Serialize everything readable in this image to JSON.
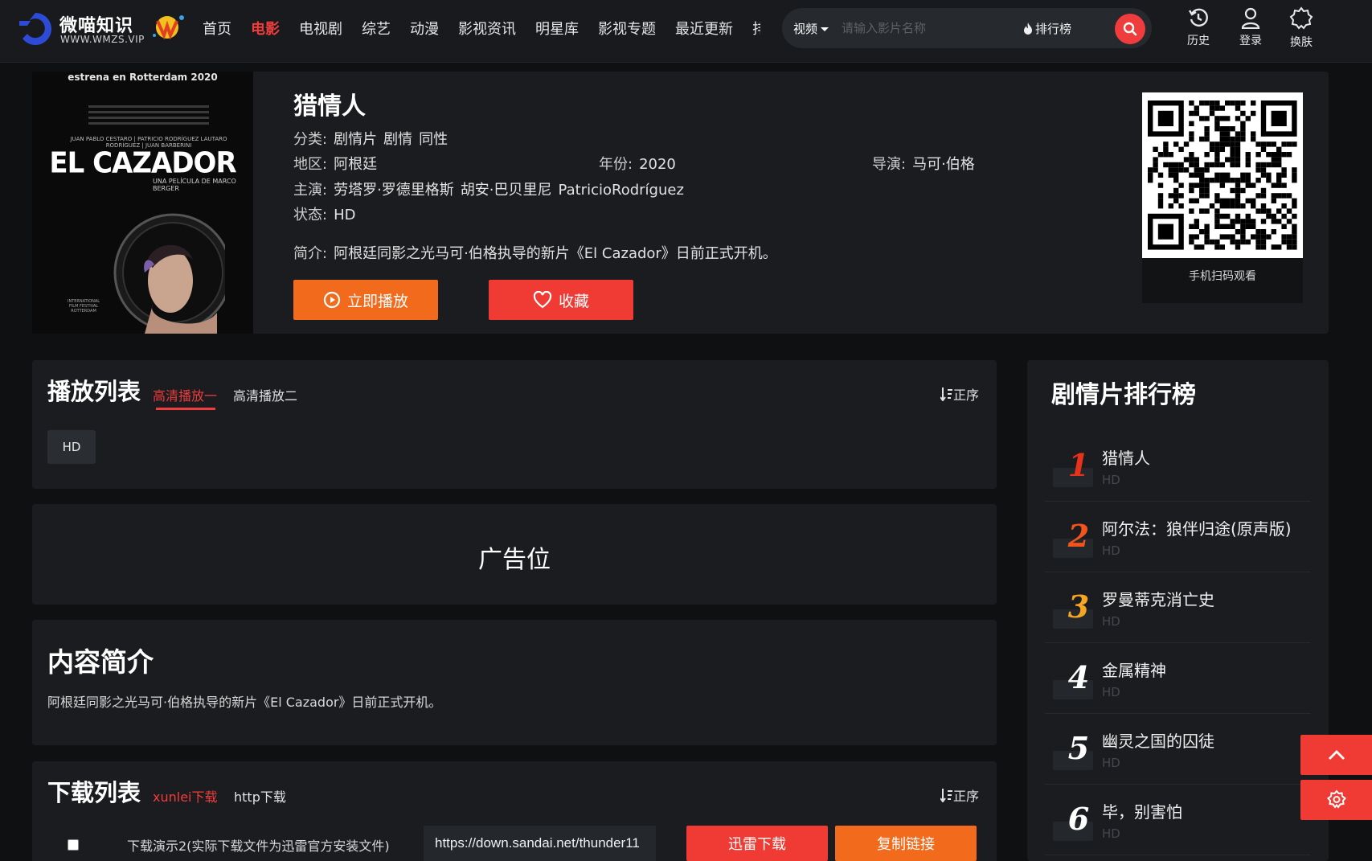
{
  "brand": {
    "name": "微喵知识",
    "url_text": "WWW.WMZS.VIP",
    "accent_color": "#f03c3c"
  },
  "nav": {
    "items": [
      {
        "label": "首页",
        "active": false
      },
      {
        "label": "电影",
        "active": true
      },
      {
        "label": "电视剧",
        "active": false
      },
      {
        "label": "综艺",
        "active": false
      },
      {
        "label": "动漫",
        "active": false
      },
      {
        "label": "影视资讯",
        "active": false
      },
      {
        "label": "明星库",
        "active": false
      },
      {
        "label": "影视专题",
        "active": false
      },
      {
        "label": "最近更新",
        "active": false
      }
    ],
    "overflow_label": "排"
  },
  "search": {
    "type_label": "视频",
    "placeholder": "请输入影片名称",
    "rank_label": "排行榜"
  },
  "header_tools": {
    "history": "历史",
    "login": "登录",
    "skin": "换肤"
  },
  "poster": {
    "top_line": "estrena en Rotterdam 2020",
    "names": "JUAN PABLO CESTARO | PATRICIO RODRÍGUEZ LAUTARO RODRÍGUEZ | JUAN BARBERINI",
    "title": "EL CAZADOR",
    "subtitle": "UNA PELÍCULA DE MARCO BERGER",
    "festival": "INTERNATIONAL FILM FESTIVAL ROTTERDAM"
  },
  "movie": {
    "title": "猎情人",
    "category_label": "分类:",
    "categories": [
      "剧情片",
      "剧情",
      "同性"
    ],
    "region_label": "地区:",
    "region": "阿根廷",
    "year_label": "年份:",
    "year": "2020",
    "director_label": "导演:",
    "director": "马可·伯格",
    "cast_label": "主演:",
    "cast": [
      "劳塔罗·罗德里格斯",
      "胡安·巴贝里尼",
      "PatricioRodríguez"
    ],
    "status_label": "状态:",
    "status": "HD",
    "synopsis_label": "简介:",
    "synopsis": "阿根廷同影之光马可·伯格执导的新片《El Cazador》日前正式开机。",
    "play_label": "立即播放",
    "fav_label": "收藏",
    "qr_caption": "手机扫码观看"
  },
  "playlist": {
    "title": "播放列表",
    "tabs": [
      {
        "label": "高清播放一",
        "active": true
      },
      {
        "label": "高清播放二",
        "active": false
      }
    ],
    "sort_label": "正序",
    "episodes": [
      "HD"
    ]
  },
  "ad": {
    "label": "广告位"
  },
  "intro": {
    "title": "内容简介",
    "text": "阿根廷同影之光马可·伯格执导的新片《El Cazador》日前正式开机。"
  },
  "downloads": {
    "title": "下载列表",
    "tabs": [
      {
        "label": "xunlei下载",
        "active": true
      },
      {
        "label": "http下载",
        "active": false
      }
    ],
    "sort_label": "正序",
    "items": [
      {
        "name": "下载演示2(实际下载文件为迅雷官方安装文件)",
        "url": "https://down.sandai.net/thunder11",
        "thunder_label": "迅雷下载",
        "copy_label": "复制链接"
      }
    ]
  },
  "ranking": {
    "title": "剧情片排行榜",
    "items": [
      {
        "rank": "1",
        "name": "猎情人",
        "status": "HD",
        "color": "#e8321c"
      },
      {
        "rank": "2",
        "name": "阿尔法：狼伴归途(原声版)",
        "status": "HD",
        "color": "#f2541b"
      },
      {
        "rank": "3",
        "name": "罗曼蒂克消亡史",
        "status": "HD",
        "color": "#f5a623"
      },
      {
        "rank": "4",
        "name": "金属精神",
        "status": "HD",
        "color": "#ffffff"
      },
      {
        "rank": "5",
        "name": "幽灵之国的囚徒",
        "status": "HD",
        "color": "#ffffff"
      },
      {
        "rank": "6",
        "name": "毕，别害怕",
        "status": "HD",
        "color": "#ffffff"
      }
    ]
  },
  "icons": {
    "search": "search-icon",
    "history": "history-icon",
    "user": "user-icon",
    "skin": "gear-icon",
    "play": "play-circle-icon",
    "heart": "heart-icon",
    "sort": "sort-icon",
    "fire": "fire-icon",
    "back_to_top": "chevron-up-icon",
    "settings": "gear-icon"
  }
}
